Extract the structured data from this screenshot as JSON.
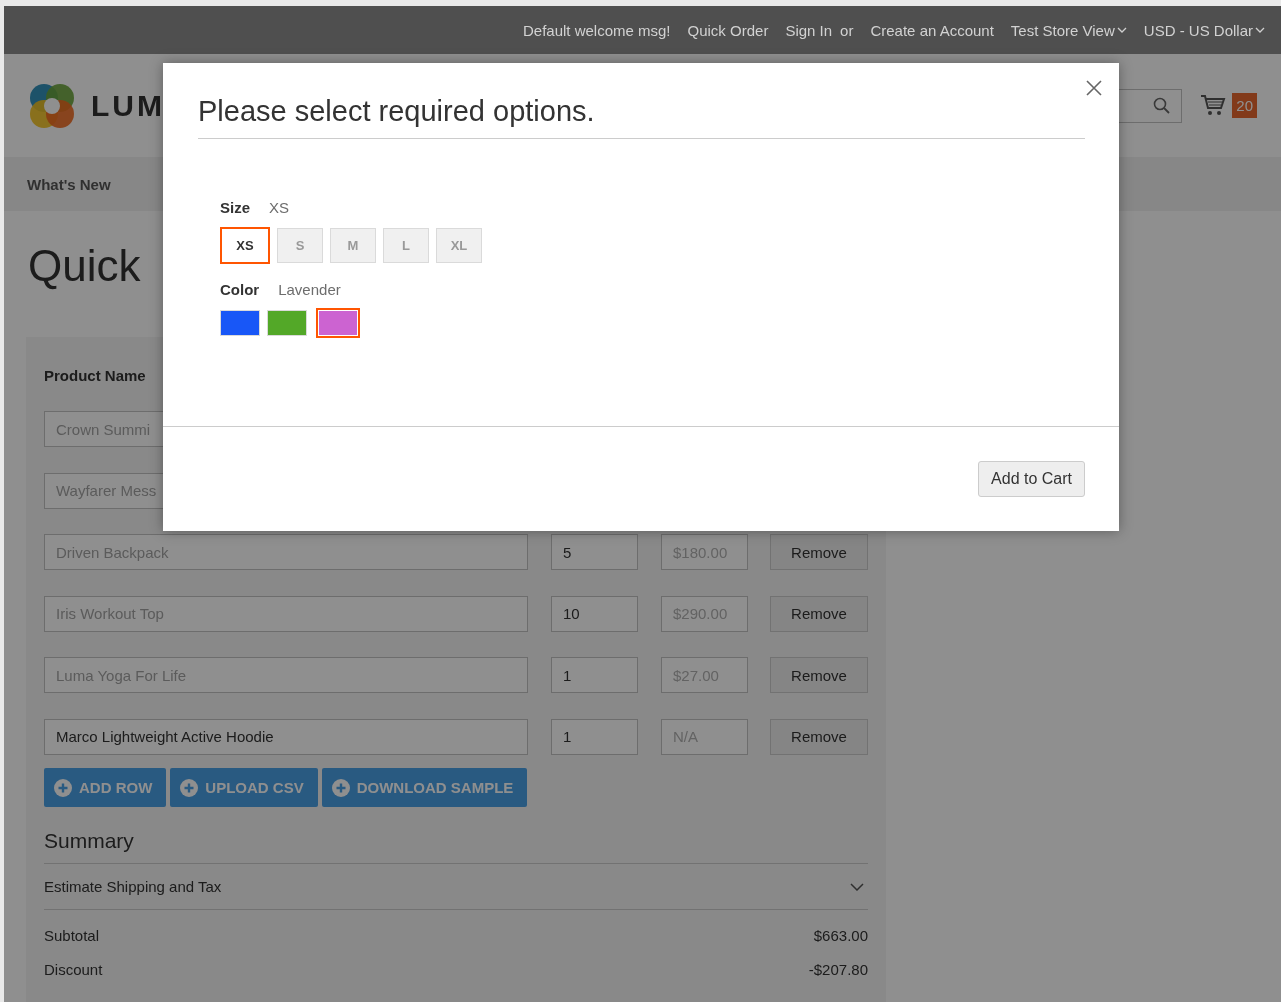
{
  "top_bar": {
    "welcome": "Default welcome msg!",
    "links": [
      "Quick Order",
      "Sign In"
    ],
    "or": "or",
    "account_link": "Create an Account",
    "switchers": [
      "Test Store View",
      "USD - US Dollar"
    ]
  },
  "header": {
    "logo_text": "LUM",
    "cart_count": "20"
  },
  "nav": {
    "items": [
      "What's New"
    ]
  },
  "page_title": "Quick",
  "form": {
    "column_header": "Product Name",
    "rows": [
      {
        "product": "Crown Summi",
        "disabled": true
      },
      {
        "product": "Wayfarer Mess",
        "disabled": true
      },
      {
        "product": "Driven Backpack",
        "disabled": true,
        "qty": "5",
        "price": "$180.00",
        "remove": "Remove"
      },
      {
        "product": "Iris Workout Top",
        "disabled": true,
        "qty": "10",
        "price": "$290.00",
        "remove": "Remove"
      },
      {
        "product": "Luma Yoga For Life",
        "disabled": true,
        "qty": "1",
        "price": "$27.00",
        "remove": "Remove"
      },
      {
        "product": "Marco Lightweight Active Hoodie",
        "disabled": false,
        "qty": "1",
        "price": "N/A",
        "remove": "Remove"
      }
    ],
    "actions": [
      "ADD ROW",
      "UPLOAD CSV",
      "DOWNLOAD SAMPLE"
    ]
  },
  "summary": {
    "title": "Summary",
    "estimate": "Estimate Shipping and Tax",
    "expanded": false,
    "lines": [
      {
        "label": "Subtotal",
        "value": "$663.00"
      },
      {
        "label": "Discount",
        "value": "-$207.80"
      }
    ]
  },
  "modal": {
    "title": "Please select required options.",
    "size": {
      "label": "Size",
      "value": "XS",
      "options": [
        {
          "label": "XS",
          "selected": true
        },
        {
          "label": "S",
          "selected": false
        },
        {
          "label": "M",
          "selected": false
        },
        {
          "label": "L",
          "selected": false
        },
        {
          "label": "XL",
          "selected": false
        }
      ]
    },
    "color": {
      "label": "Color",
      "value": "Lavender",
      "options": [
        {
          "color": "#1857f7",
          "selected": false
        },
        {
          "color": "#53a828",
          "selected": false
        },
        {
          "color": "#cc63d1",
          "selected": true
        }
      ]
    },
    "button": "Add to Cart"
  }
}
